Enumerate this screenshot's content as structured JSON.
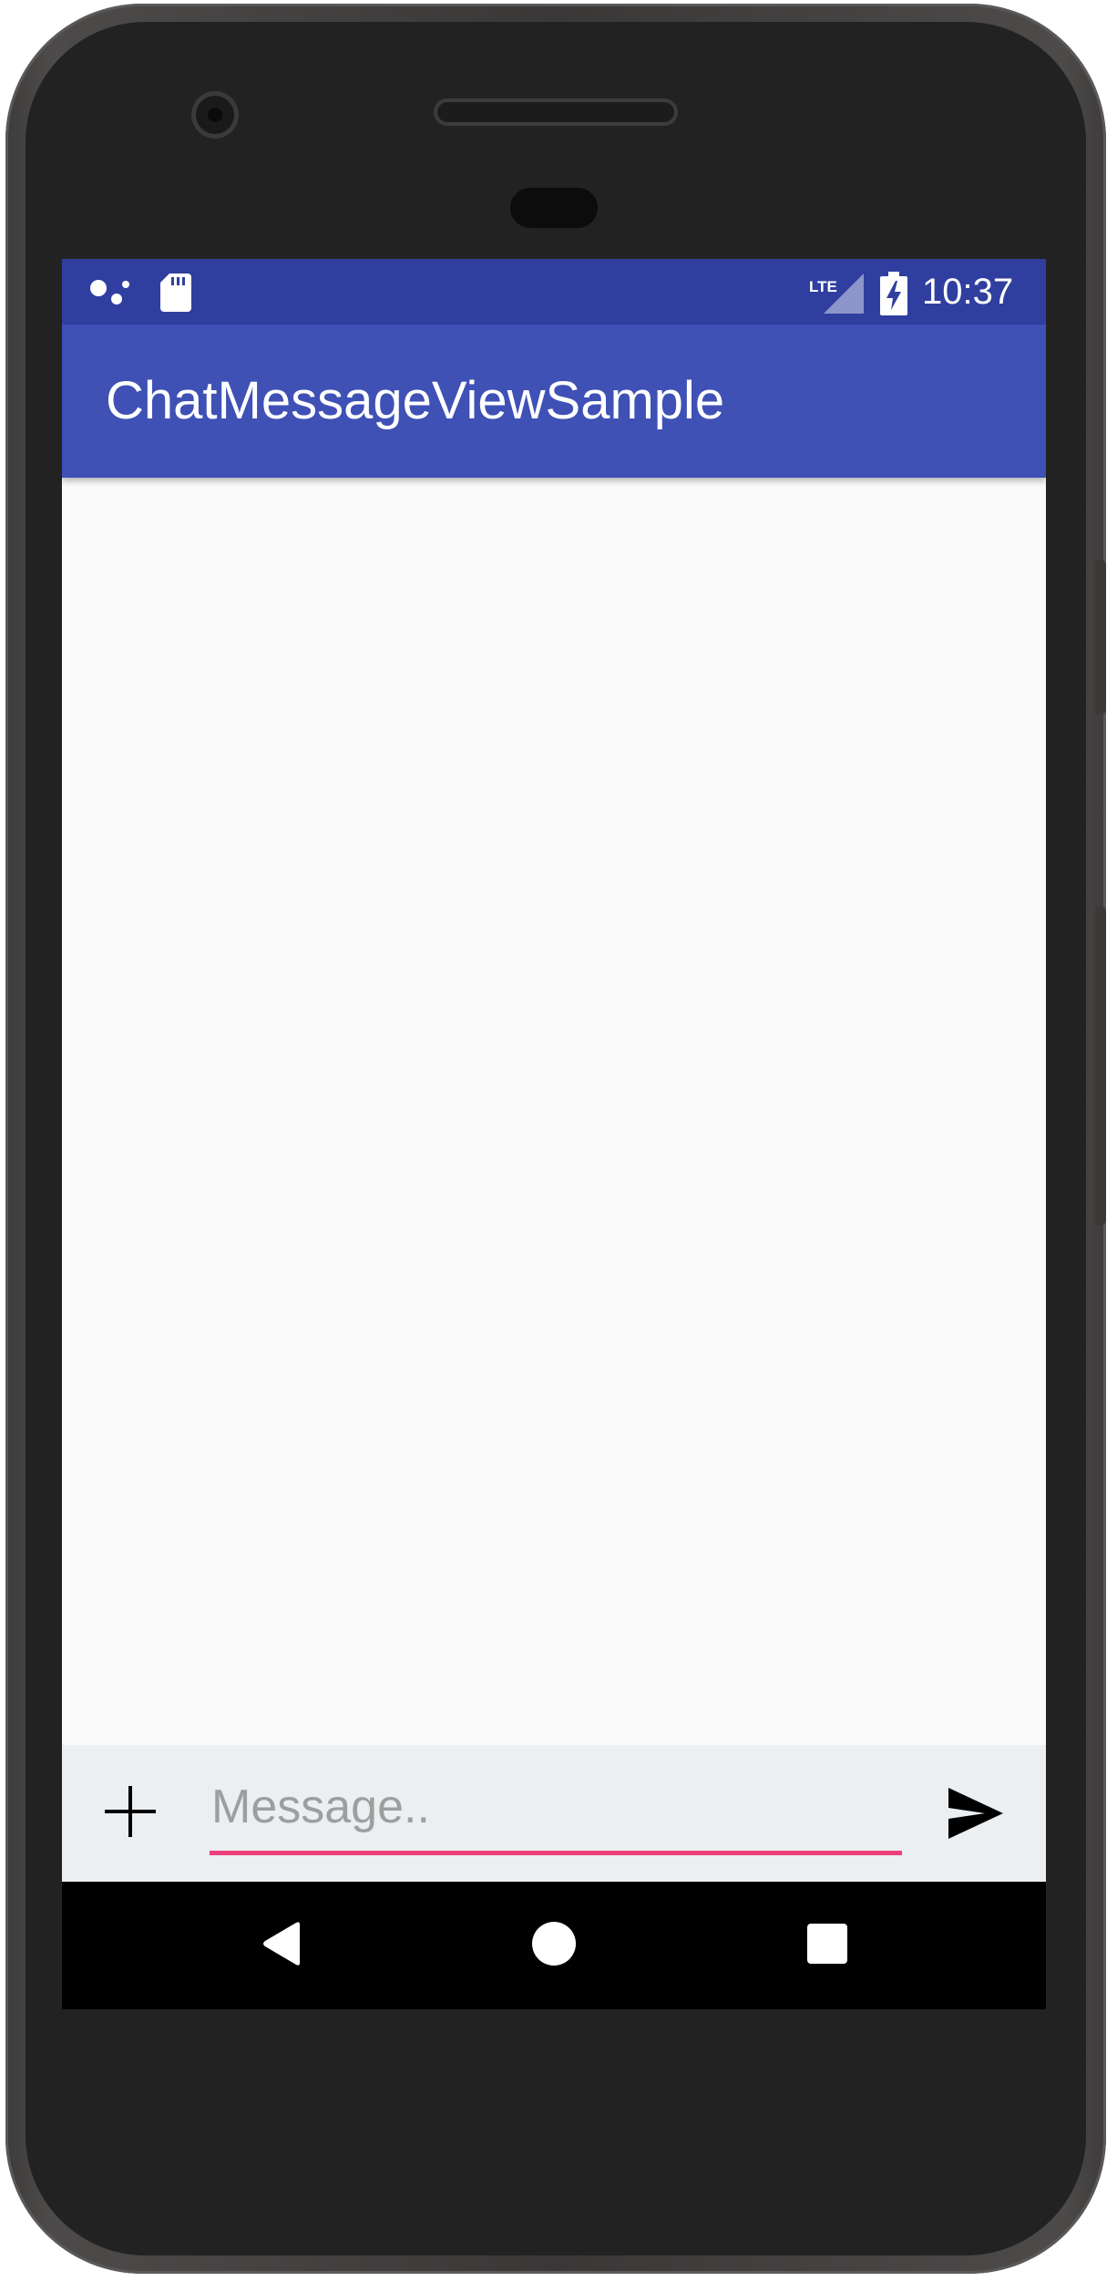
{
  "status_bar": {
    "time": "10:37",
    "network_label": "LTE",
    "icons": [
      "assistant-icon",
      "sd-card-icon",
      "lte-signal-icon",
      "battery-charging-icon"
    ]
  },
  "app_bar": {
    "title": "ChatMessageViewSample"
  },
  "composer": {
    "placeholder": "Message..",
    "value": "",
    "add_icon": "plus-icon",
    "send_icon": "send-icon"
  },
  "nav_bar": {
    "icons": [
      "back-icon",
      "home-icon",
      "recents-icon"
    ]
  },
  "colors": {
    "status_bar": "#303f9f",
    "app_bar": "#3f51b5",
    "accent": "#ec407a",
    "composer_background": "#eceff1",
    "content_background": "#fafafa"
  }
}
